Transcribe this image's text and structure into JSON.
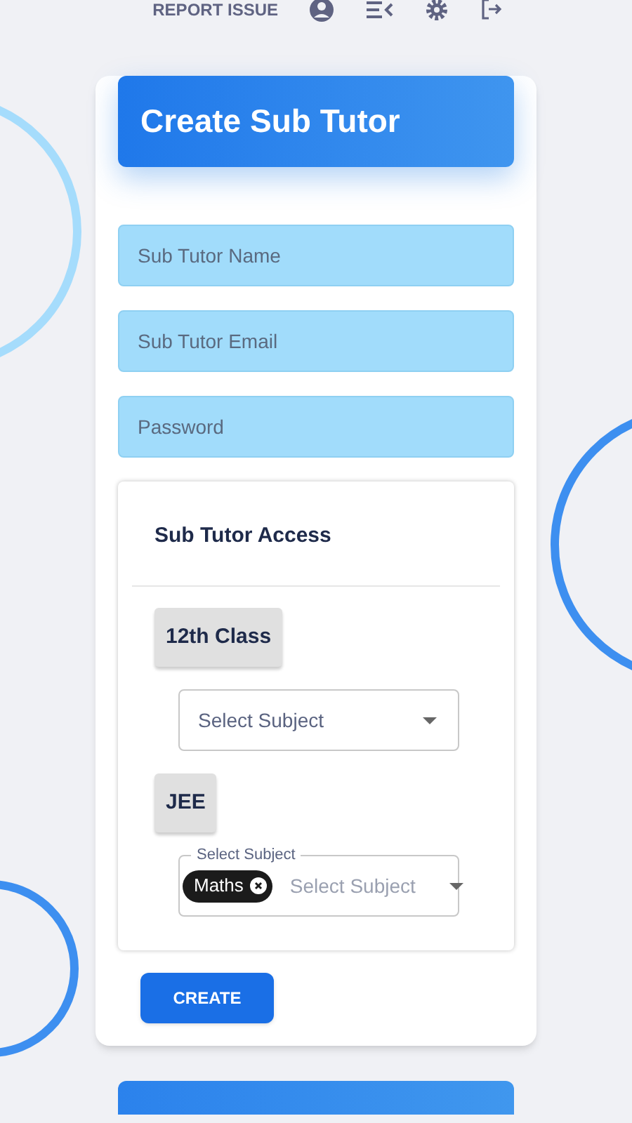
{
  "top_bar": {
    "report_link": "REPORT ISSUE"
  },
  "form": {
    "title": "Create Sub Tutor",
    "fields": [
      {
        "placeholder": "Sub Tutor Name"
      },
      {
        "placeholder": "Sub Tutor Email"
      },
      {
        "placeholder": "Password"
      }
    ],
    "access": {
      "title": "Sub Tutor Access",
      "groups": [
        {
          "label": "12th Class",
          "select": {
            "placeholder": "Select Subject"
          }
        },
        {
          "label": "JEE",
          "select": {
            "label": "Select Subject",
            "chips": [
              "Maths"
            ],
            "placeholder": "Select Subject"
          }
        }
      ]
    },
    "submit": "CREATE"
  }
}
